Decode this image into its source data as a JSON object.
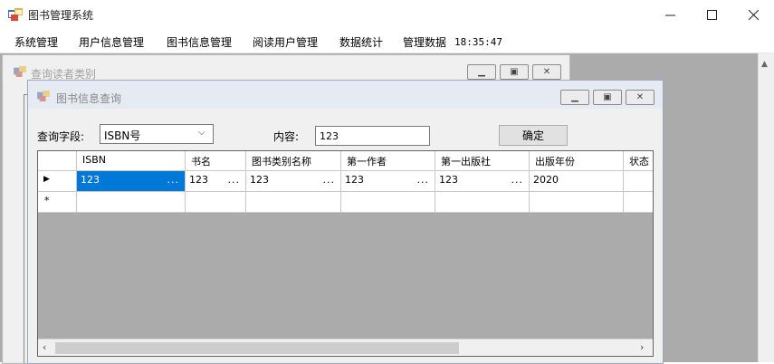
{
  "app": {
    "title": "图书管理系统",
    "icon": "app-form-icon"
  },
  "menu": {
    "items": [
      "系统管理",
      "用户信息管理",
      "图书信息管理",
      "阅读用户管理",
      "数据统计",
      "管理数据"
    ],
    "clock": "18:35:47"
  },
  "reader_window": {
    "title": "查询读者类别"
  },
  "book_window": {
    "title": "图书信息查询",
    "field_label": "查询字段:",
    "field_value": "ISBN号",
    "content_label": "内容:",
    "content_value": "123",
    "ok_label": "确定"
  },
  "grid": {
    "columns": [
      "ISBN",
      "书名",
      "图书类别名称",
      "第一作者",
      "第一出版社",
      "出版年份",
      "状态"
    ],
    "row": [
      "123",
      "123",
      "123",
      "123",
      "123",
      "2020",
      ""
    ],
    "ellipsis": "..."
  },
  "colors": {
    "selection": "#0078d7",
    "mdi_background": "#ababab",
    "title_active": "#e6eaf2"
  }
}
